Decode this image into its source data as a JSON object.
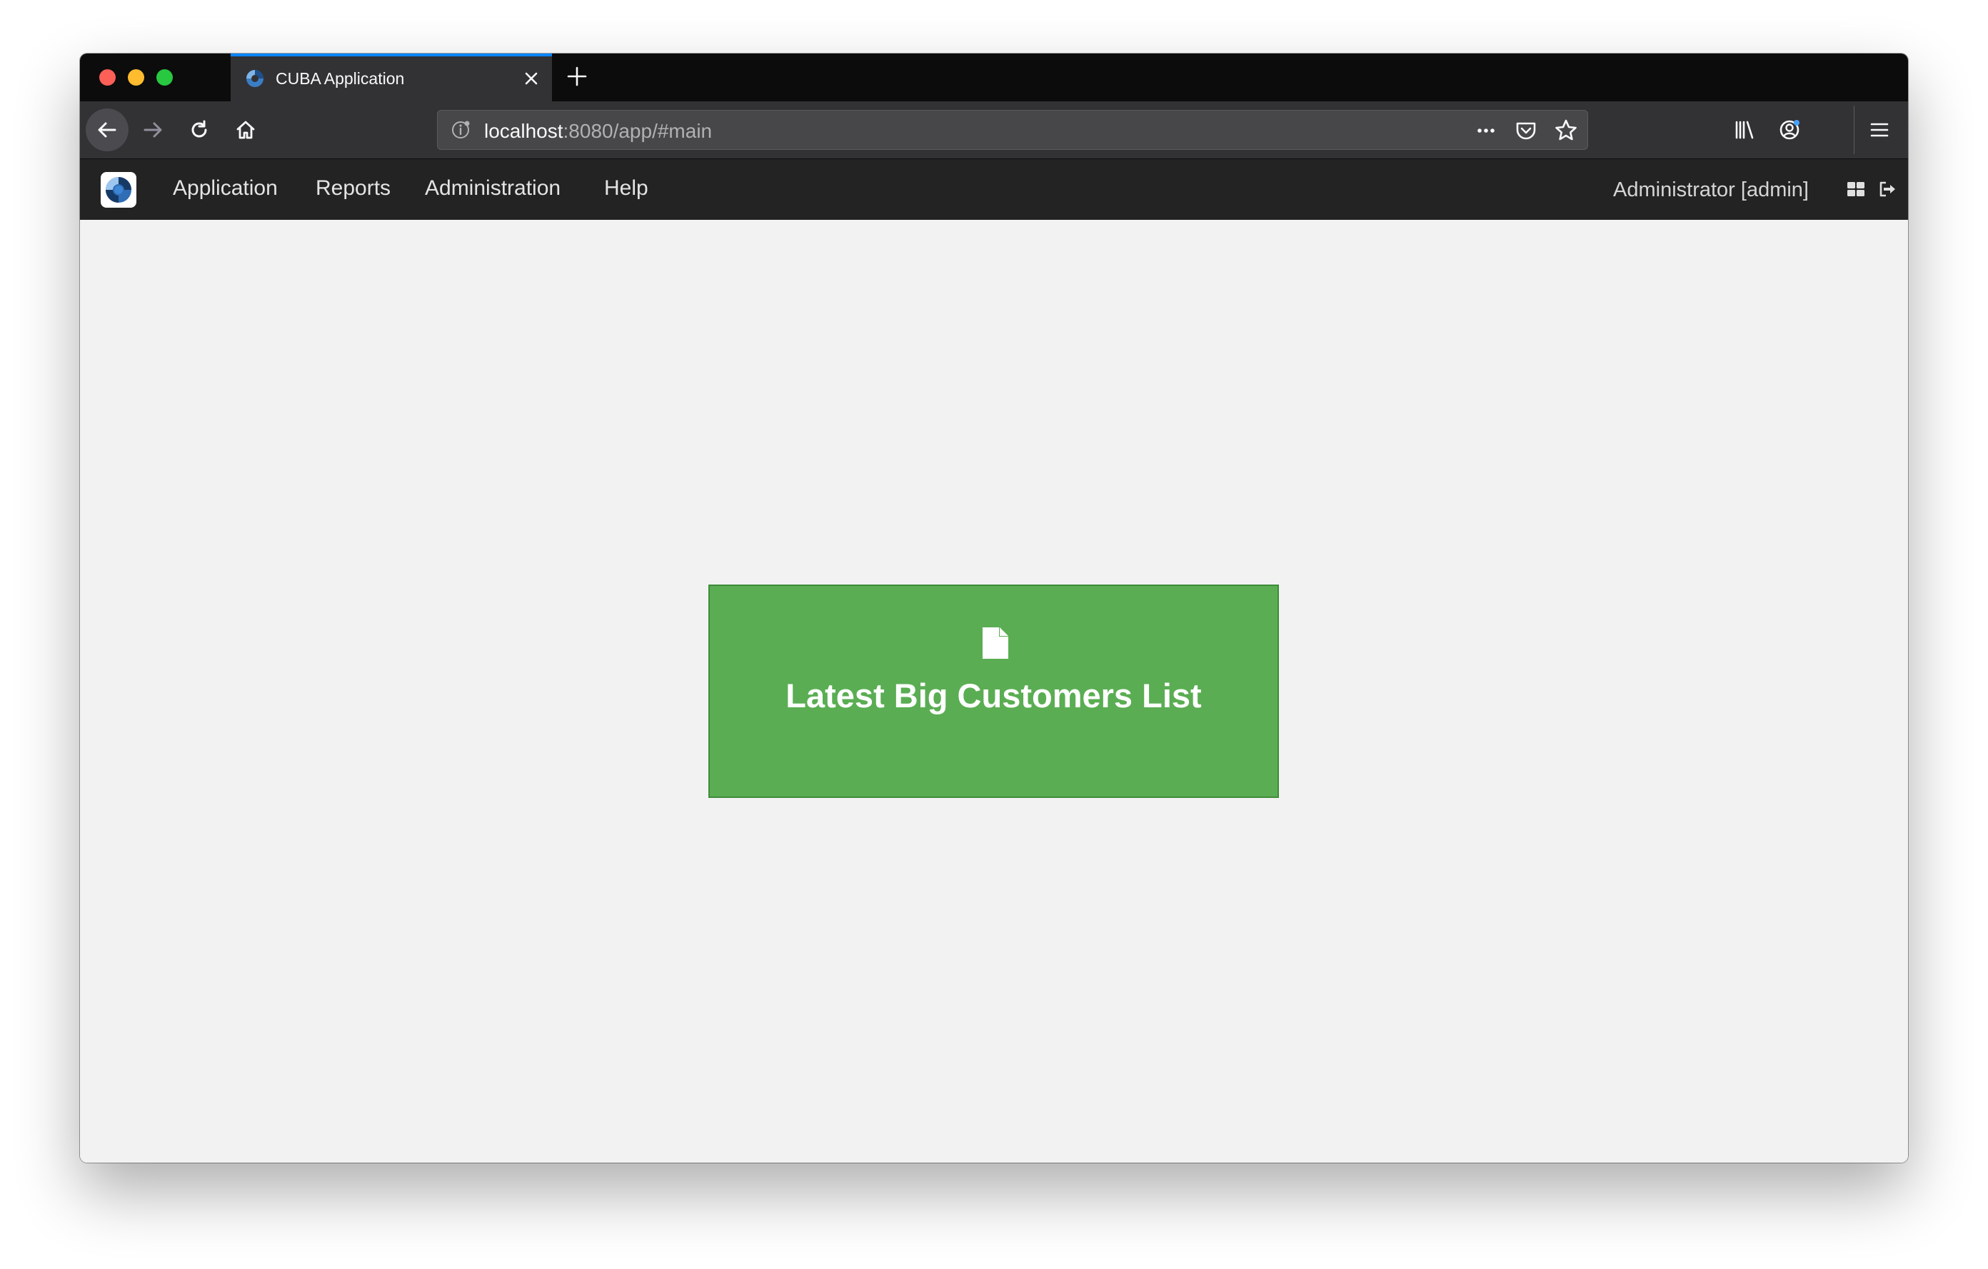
{
  "browser": {
    "tab": {
      "title": "CUBA Application",
      "favicon": "cuba-logo-icon"
    },
    "new_tab_icon": "plus-icon",
    "url": {
      "host": "localhost",
      "rest": ":8080/app/#main"
    },
    "icons": {
      "back": "arrow-left-icon",
      "forward": "arrow-right-icon",
      "reload": "reload-icon",
      "home": "home-icon",
      "info": "info-icon",
      "page_actions": "more-dots-icon",
      "pocket": "pocket-icon",
      "bookmark": "star-icon",
      "library": "library-icon",
      "account": "account-icon",
      "menu": "hamburger-menu-icon"
    },
    "colors": {
      "tab_accent": "#0a84ff"
    }
  },
  "app": {
    "menu": [
      {
        "label": "Application"
      },
      {
        "label": "Reports"
      },
      {
        "label": "Administration"
      },
      {
        "label": "Help"
      }
    ],
    "user": "Administrator [admin]",
    "icons": {
      "logo": "cuba-logo-icon",
      "switch_layout": "grid-icon",
      "logout": "logout-icon"
    }
  },
  "content": {
    "report_tile": {
      "label": "Latest Big Customers List",
      "icon": "file-icon",
      "color": "#5aad53"
    }
  }
}
